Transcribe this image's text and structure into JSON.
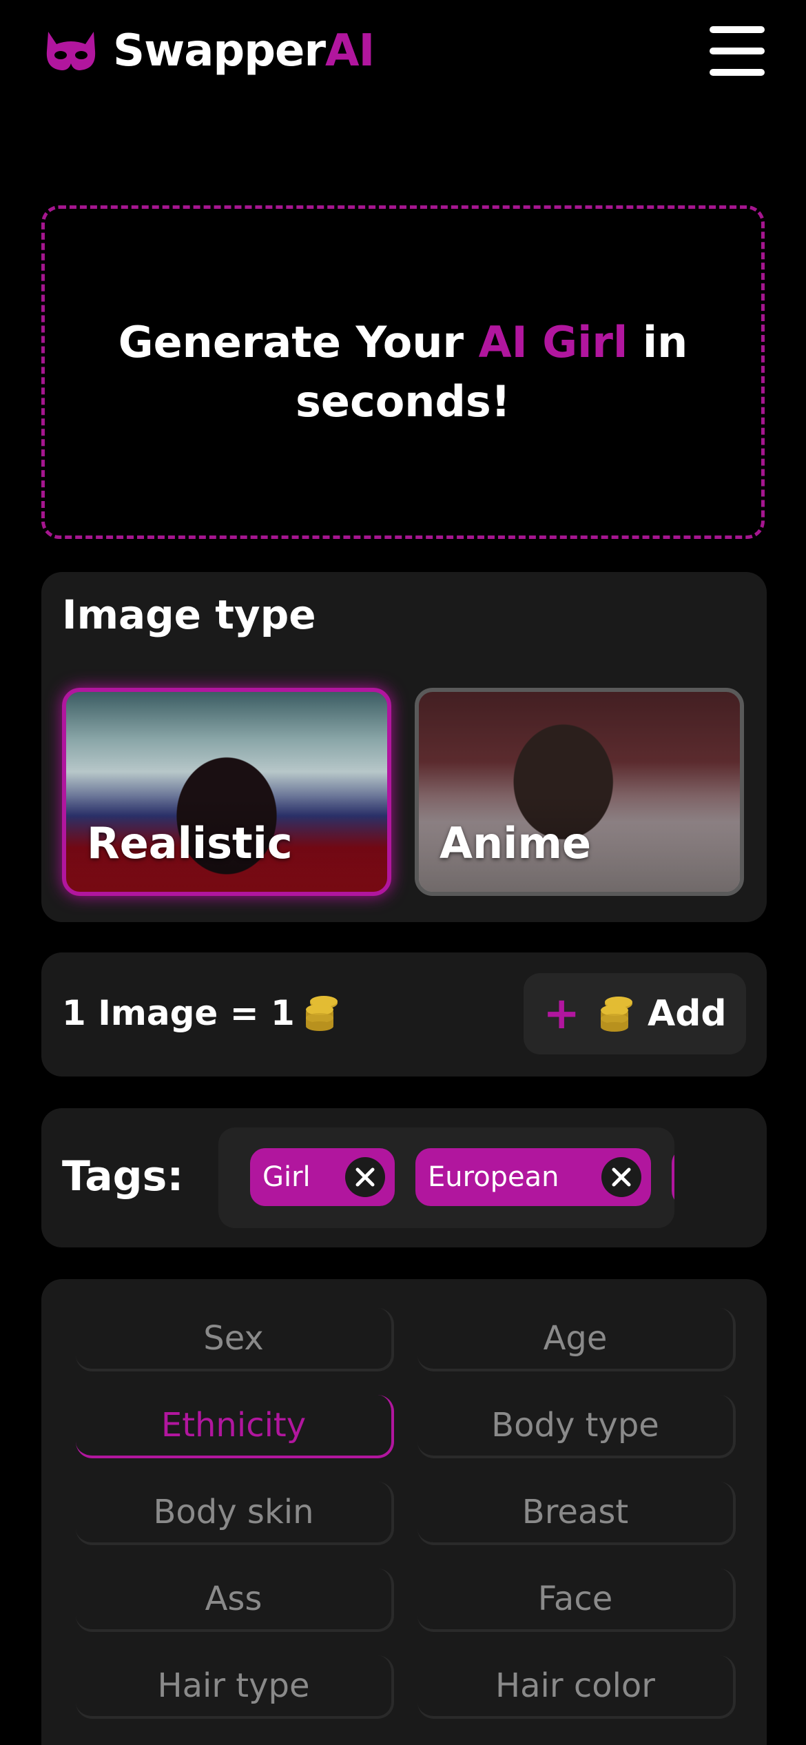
{
  "header": {
    "brand_prefix": "Swapper",
    "brand_suffix": "AI",
    "brand_color": "#b1169e",
    "logo_icon": "devil-mask-icon",
    "menu_icon": "hamburger-menu-icon"
  },
  "hero": {
    "text_before": "Generate Your ",
    "highlight": "AI Girl",
    "text_after": " in seconds!"
  },
  "image_type": {
    "title": "Image type",
    "options": [
      {
        "label": "Realistic",
        "selected": true
      },
      {
        "label": "Anime",
        "selected": false
      }
    ]
  },
  "pricing": {
    "text": "1 Image = 1",
    "coin_icon": "coins-icon",
    "add_plus": "+",
    "add_label": "Add"
  },
  "tags": {
    "label": "Tags:",
    "items": [
      {
        "label": "Girl"
      },
      {
        "label": "European"
      }
    ]
  },
  "filters": {
    "items": [
      {
        "label": "Sex",
        "active": false
      },
      {
        "label": "Age",
        "active": false
      },
      {
        "label": "Ethnicity",
        "active": true
      },
      {
        "label": "Body type",
        "active": false
      },
      {
        "label": "Body skin",
        "active": false
      },
      {
        "label": "Breast",
        "active": false
      },
      {
        "label": "Ass",
        "active": false
      },
      {
        "label": "Face",
        "active": false
      },
      {
        "label": "Hair type",
        "active": false
      },
      {
        "label": "Hair color",
        "active": false
      }
    ]
  }
}
